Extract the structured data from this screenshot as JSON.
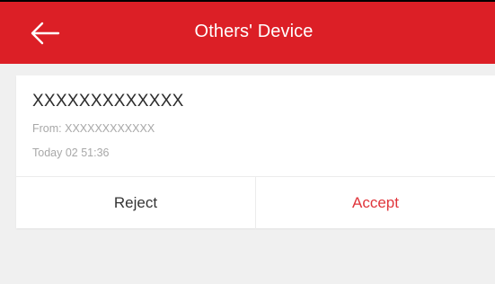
{
  "appbar": {
    "title": "Others' Device",
    "back_icon": "back-arrow-icon",
    "background_color": "#dc1f26"
  },
  "card": {
    "device_name": "XXXXXXXXXXXXX",
    "from_text": "From: XXXXXXXXXXXX",
    "time_text": "Today 02 51:36",
    "reject_label": "Reject",
    "accept_label": "Accept",
    "accept_color": "#e0353b"
  }
}
